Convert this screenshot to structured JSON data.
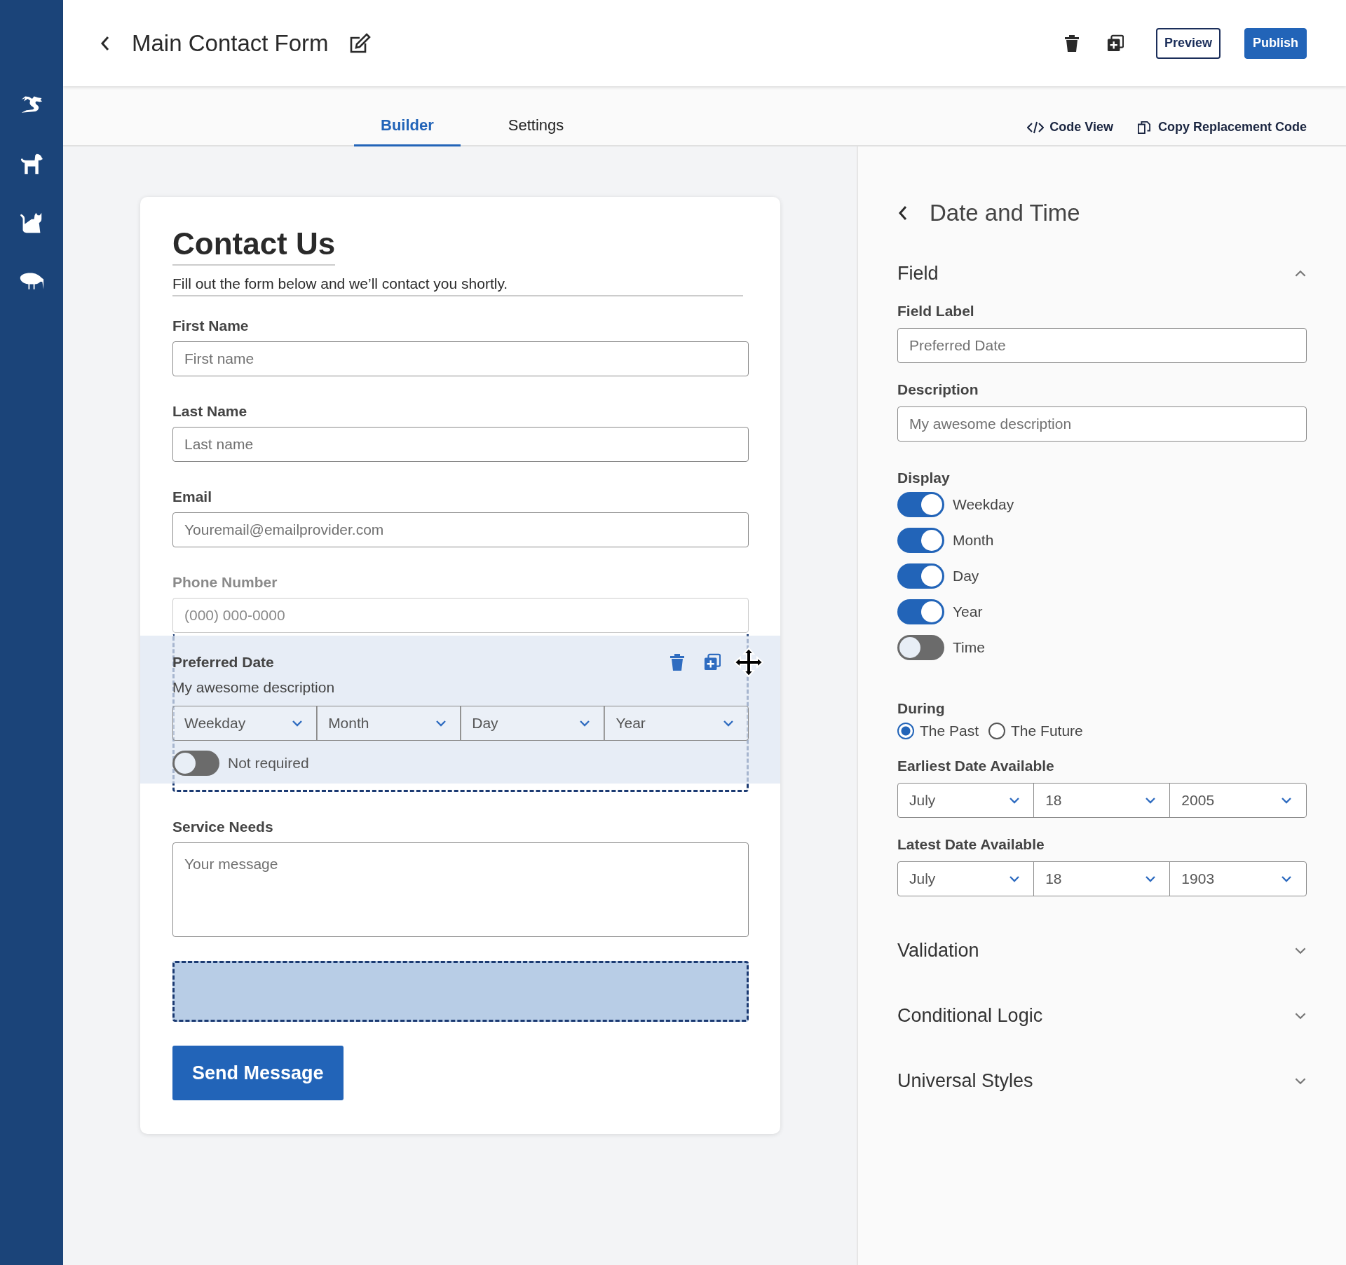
{
  "header": {
    "title": "Main Contact Form",
    "buttons": [
      {
        "label": "Preview",
        "kind": "outline"
      },
      {
        "label": "Publish",
        "kind": "primary"
      }
    ]
  },
  "tabs": [
    {
      "label": "Builder",
      "selected": true
    },
    {
      "label": "Settings",
      "selected": false
    }
  ],
  "tab_links": [
    "Code View",
    "Copy Replacement Code"
  ],
  "form": {
    "title": "Contact Us",
    "subtitle": "Fill out the form below and we’ll contact you shortly.",
    "fields": [
      {
        "kind": "input",
        "label": "First Name",
        "placeholder": "First name"
      },
      {
        "kind": "input",
        "label": "Last Name",
        "placeholder": "Last name"
      },
      {
        "kind": "input",
        "label": "Email",
        "placeholder": "Youremail@emailprovider.com"
      },
      {
        "kind": "phone",
        "label": "Phone Number",
        "placeholder": "(000) 000-0000"
      },
      {
        "kind": "textarea",
        "label": "Service Needs",
        "placeholder": "Your message"
      }
    ],
    "submit": "Send Message"
  },
  "dragged_field": {
    "label": "Preferred Date",
    "description": "My awesome description",
    "selects": [
      "Weekday",
      "Month",
      "Day",
      "Year"
    ],
    "toggle": {
      "label": "Not required",
      "on": false
    }
  },
  "panel": {
    "title": "Date and Time",
    "field_section": {
      "title": "Field",
      "expanded": true,
      "field_label": {
        "label": "Field Label",
        "placeholder": "Preferred Date"
      },
      "description": {
        "label": "Description",
        "placeholder": "My awesome description"
      },
      "display": {
        "label": "Display",
        "options": [
          {
            "label": "Weekday",
            "on": true
          },
          {
            "label": "Month",
            "on": true
          },
          {
            "label": "Day",
            "on": true
          },
          {
            "label": "Year",
            "on": true
          },
          {
            "label": "Time",
            "on": false
          }
        ]
      },
      "during": {
        "label": "During",
        "options": [
          {
            "label": "The Past",
            "selected": true
          },
          {
            "label": "The Future",
            "selected": false
          }
        ]
      },
      "earliest": {
        "label": "Earliest Date Available",
        "selects": [
          "July",
          "18",
          "2005"
        ]
      },
      "latest": {
        "label": "Latest Date Available",
        "selects": [
          "July",
          "18",
          "1903"
        ]
      }
    },
    "sections": [
      {
        "title": "Validation",
        "expanded": false
      },
      {
        "title": "Conditional Logic",
        "expanded": false
      },
      {
        "title": "Universal Styles",
        "expanded": false
      }
    ]
  }
}
